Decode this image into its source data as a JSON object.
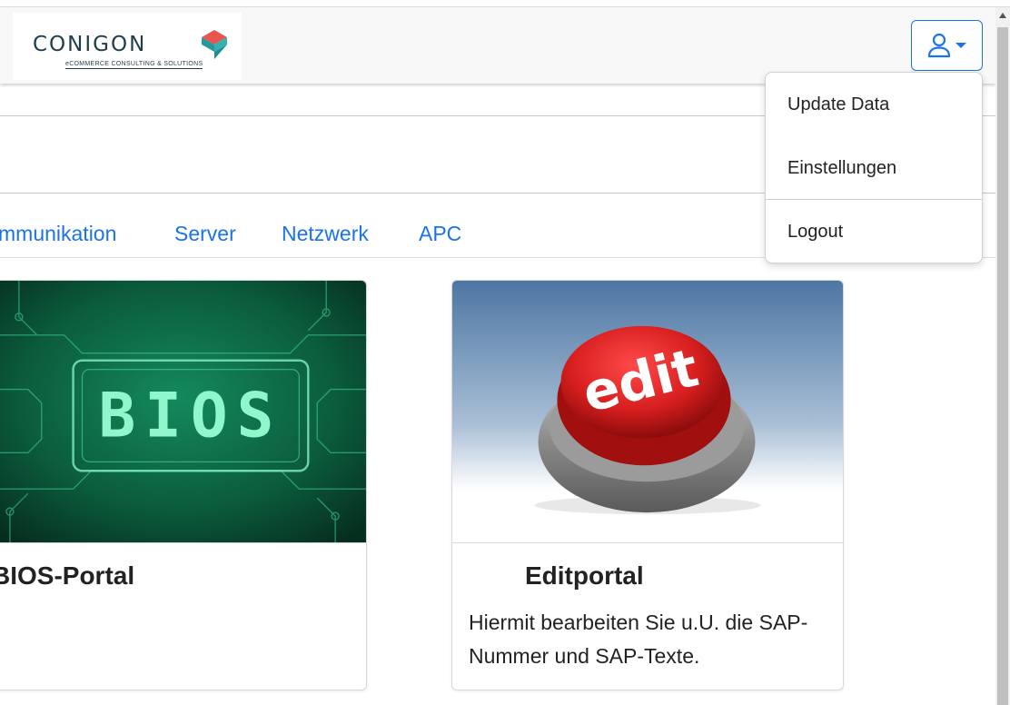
{
  "logo": {
    "wordmark": "CONIGON",
    "tagline": "eCOMMERCE CONSULTING & SOLUTIONS"
  },
  "header": {
    "user_menu_icon": "user-icon",
    "caret_icon": "caret-down-icon"
  },
  "nav_tabs": [
    {
      "label": "mmunikation"
    },
    {
      "label": "Server"
    },
    {
      "label": "Netzwerk"
    },
    {
      "label": "APC"
    }
  ],
  "cards": [
    {
      "title": "BIOS-Portal",
      "image_text": "BIOS",
      "description": ""
    },
    {
      "title": "Editportal",
      "image_text": "edit",
      "description": "Hiermit bearbeiten Sie u.U. die SAP-Nummer und SAP-Texte."
    }
  ],
  "dropdown": {
    "items": [
      {
        "label": "Update Data"
      },
      {
        "label": "Einstellungen"
      },
      {
        "label": "Logout"
      }
    ]
  },
  "colors": {
    "accent": "#1a73e8",
    "logo_dark": "#1f3d4a",
    "logo_red": "#e8554e",
    "logo_teal": "#2fb3b5",
    "bios_green": "#0b5c3d",
    "edit_red": "#d81f1f"
  }
}
